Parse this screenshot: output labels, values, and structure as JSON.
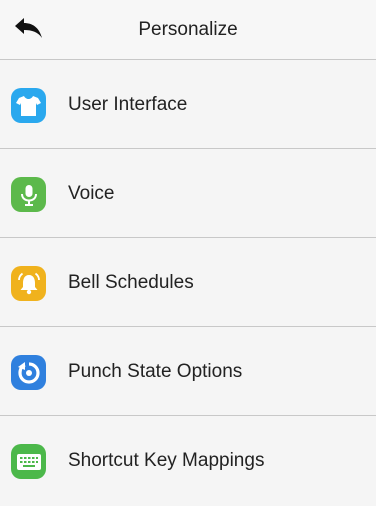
{
  "header": {
    "title": "Personalize",
    "back_icon": "back-arrow-icon"
  },
  "menu": {
    "items": [
      {
        "label": "User Interface",
        "icon": "shirt-icon",
        "color": "#2aa8ee"
      },
      {
        "label": "Voice",
        "icon": "microphone-icon",
        "color": "#5cb94b"
      },
      {
        "label": "Bell Schedules",
        "icon": "bell-icon",
        "color": "#f0b21d"
      },
      {
        "label": "Punch State Options",
        "icon": "punch-state-icon",
        "color": "#2f80de"
      },
      {
        "label": "Shortcut Key Mappings",
        "icon": "keyboard-icon",
        "color": "#4cb84a"
      }
    ]
  }
}
